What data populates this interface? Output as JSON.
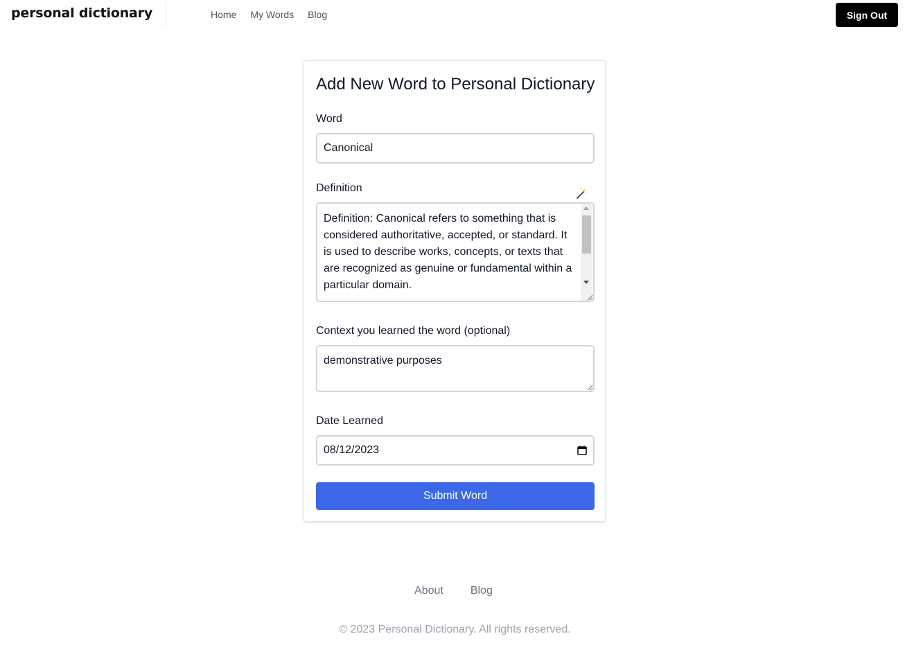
{
  "header": {
    "brand": "personal dictionary",
    "nav": [
      {
        "label": "Home"
      },
      {
        "label": "My Words"
      },
      {
        "label": "Blog"
      }
    ],
    "sign_out_label": "Sign Out"
  },
  "form": {
    "title": "Add New Word to Personal Dictionary",
    "word": {
      "label": "Word",
      "value": "Canonical"
    },
    "definition": {
      "label": "Definition",
      "value": "Definition: Canonical refers to something that is considered authoritative, accepted, or standard. It is used to describe works, concepts, or texts that are recognized as genuine or fundamental within a particular domain.",
      "icon": "magic-wand-icon"
    },
    "context": {
      "label": "Context you learned the word (optional)",
      "value": "demonstrative purposes"
    },
    "date": {
      "label": "Date Learned",
      "value": "08/12/2023",
      "icon": "calendar-icon"
    },
    "submit_label": "Submit Word",
    "accent_color": "#3b68e8"
  },
  "footer": {
    "links": [
      {
        "label": "About"
      },
      {
        "label": "Blog"
      }
    ],
    "copyright": "© 2023 Personal Dictionary. All rights reserved."
  }
}
